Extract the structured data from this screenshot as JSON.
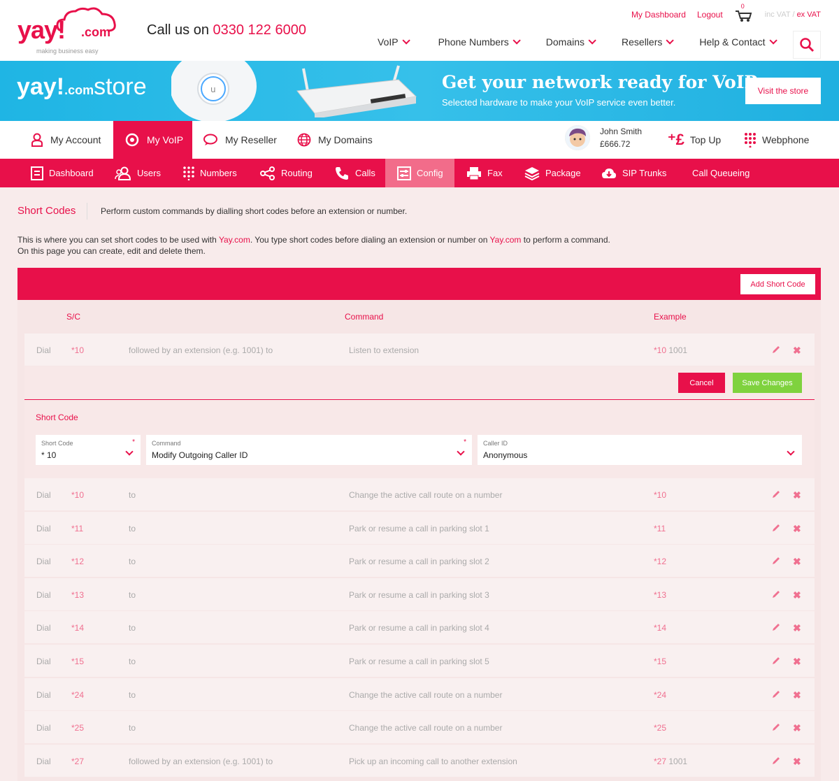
{
  "header": {
    "logo_main": "yay!",
    "logo_com": ".com",
    "logo_tagline": "making business easy",
    "call_prefix": "Call us on",
    "phone": "0330 122 6000",
    "my_dashboard": "My Dashboard",
    "logout": "Logout",
    "cart_count": "0",
    "inc_vat": "inc VAT",
    "vat_sep": "/",
    "ex_vat": "ex VAT",
    "nav": [
      "VoIP",
      "Phone Numbers",
      "Domains",
      "Resellers",
      "Help & Contact"
    ]
  },
  "banner": {
    "store_logo_a": "yay!",
    "store_logo_com": ".com",
    "store_logo_b": "store",
    "title": "Get your network ready for VoIP",
    "subtitle": "Selected hardware to make your VoIP service even better.",
    "visit_label": "Visit the store"
  },
  "account_bar": {
    "tabs": [
      "My Account",
      "My VoIP",
      "My Reseller",
      "My Domains"
    ],
    "user_name": "John Smith",
    "balance": "£666.72",
    "top_up": "Top Up",
    "webphone": "Webphone"
  },
  "sub_nav": [
    "Dashboard",
    "Users",
    "Numbers",
    "Routing",
    "Calls",
    "Config",
    "Fax",
    "Package",
    "SIP Trunks",
    "Call Queueing"
  ],
  "page": {
    "title": "Short Codes",
    "description": "Perform custom commands by dialling short codes before an extension or number.",
    "intro_1": "This is where you can set short codes to be used with ",
    "intro_link_1": "Yay.com",
    "intro_2": ". You type short codes before dialing an extension or number on ",
    "intro_link_2": "Yay.com",
    "intro_3": " to perform a command.",
    "intro_line2": "On this page you can create, edit and delete them.",
    "add_label": "Add Short Code"
  },
  "table": {
    "headers": {
      "sc": "S/C",
      "command": "Command",
      "example": "Example"
    },
    "editing_row": {
      "dial": "Dial",
      "code": "*10",
      "target": "followed by an extension (e.g. 1001) to",
      "command": "Listen to extension",
      "example_code": "*10",
      "example_num": "1001"
    },
    "edit_panel": {
      "cancel": "Cancel",
      "save": "Save Changes",
      "label": "Short Code",
      "short_code_label": "Short Code",
      "short_code_value": "* 10",
      "command_label": "Command",
      "command_value": "Modify Outgoing Caller ID",
      "caller_id_label": "Caller ID",
      "caller_id_value": "Anonymous",
      "required_mark": "*"
    },
    "rows": [
      {
        "dial": "Dial",
        "code": "*10",
        "target": "to",
        "command": "Change the active call route on a number",
        "example_code": "*10",
        "example_num": ""
      },
      {
        "dial": "Dial",
        "code": "*11",
        "target": "to",
        "command": "Park or resume a call in parking slot 1",
        "example_code": "*11",
        "example_num": ""
      },
      {
        "dial": "Dial",
        "code": "*12",
        "target": "to",
        "command": "Park or resume a call in parking slot 2",
        "example_code": "*12",
        "example_num": ""
      },
      {
        "dial": "Dial",
        "code": "*13",
        "target": "to",
        "command": "Park or resume a call in parking slot 3",
        "example_code": "*13",
        "example_num": ""
      },
      {
        "dial": "Dial",
        "code": "*14",
        "target": "to",
        "command": "Park or resume a call in parking slot 4",
        "example_code": "*14",
        "example_num": ""
      },
      {
        "dial": "Dial",
        "code": "*15",
        "target": "to",
        "command": "Park or resume a call in parking slot 5",
        "example_code": "*15",
        "example_num": ""
      },
      {
        "dial": "Dial",
        "code": "*24",
        "target": "to",
        "command": "Change the active call route on a number",
        "example_code": "*24",
        "example_num": ""
      },
      {
        "dial": "Dial",
        "code": "*25",
        "target": "to",
        "command": "Change the active call route on a number",
        "example_code": "*25",
        "example_num": ""
      },
      {
        "dial": "Dial",
        "code": "*27",
        "target": "followed by an extension (e.g. 1001) to",
        "command": "Pick up an incoming call to another extension",
        "example_code": "*27",
        "example_num": "1001"
      }
    ]
  },
  "colors": {
    "brand": "#e8104a",
    "banner": "#29b8e6",
    "save": "#7fd23e"
  },
  "icons": {
    "search": "search-icon",
    "cart": "cart-icon",
    "edit": "pencil-icon",
    "delete": "close-icon"
  }
}
